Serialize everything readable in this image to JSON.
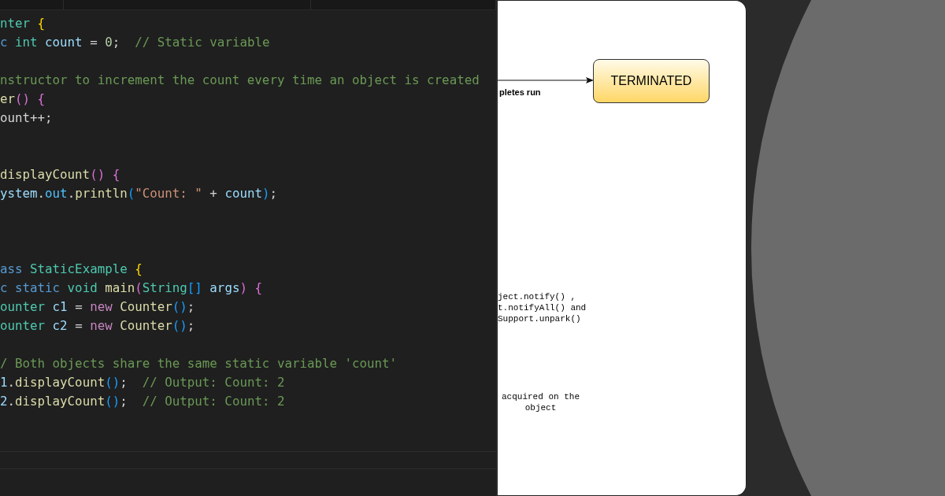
{
  "editor": {
    "lines": [
      {
        "kind": "code",
        "tokens": [
          {
            "text": "nter",
            "kind": "type"
          },
          {
            "text": " {",
            "kind": "brace"
          }
        ]
      },
      {
        "kind": "code",
        "tokens": [
          {
            "text": "c",
            "kind": "keyword"
          },
          {
            "text": " int",
            "kind": "type"
          },
          {
            "text": " count",
            "kind": "variable"
          },
          {
            "text": " = ",
            "kind": "plain"
          },
          {
            "text": "0",
            "kind": "number"
          },
          {
            "text": ";  ",
            "kind": "plain"
          },
          {
            "text": "// Static variable",
            "kind": "comment"
          }
        ]
      },
      {
        "kind": "blank"
      },
      {
        "kind": "code",
        "tokens": [
          {
            "text": "nstructor to increment the count every time an object is created",
            "kind": "comment"
          }
        ]
      },
      {
        "kind": "code",
        "tokens": [
          {
            "text": "er",
            "kind": "function"
          },
          {
            "text": "() {",
            "kind": "paren"
          }
        ]
      },
      {
        "kind": "code",
        "tokens": [
          {
            "text": "ount++;",
            "kind": "plain"
          }
        ]
      },
      {
        "kind": "blank"
      },
      {
        "kind": "blank"
      },
      {
        "kind": "code",
        "tokens": [
          {
            "text": "displayCount",
            "kind": "function"
          },
          {
            "text": "() {",
            "kind": "paren"
          }
        ]
      },
      {
        "kind": "code",
        "tokens": [
          {
            "text": "ystem",
            "kind": "variable"
          },
          {
            "text": ".",
            "kind": "plain"
          },
          {
            "text": "out",
            "kind": "constant"
          },
          {
            "text": ".",
            "kind": "plain"
          },
          {
            "text": "println",
            "kind": "function"
          },
          {
            "text": "(",
            "kind": "bracket"
          },
          {
            "text": "\"Count: \"",
            "kind": "string"
          },
          {
            "text": " + ",
            "kind": "plain"
          },
          {
            "text": "count",
            "kind": "variable"
          },
          {
            "text": ")",
            "kind": "bracket"
          },
          {
            "text": ";",
            "kind": "plain"
          }
        ]
      },
      {
        "kind": "blank"
      },
      {
        "kind": "blank"
      },
      {
        "kind": "blank"
      },
      {
        "kind": "code",
        "tokens": [
          {
            "text": "ass",
            "kind": "keyword"
          },
          {
            "text": " StaticExample",
            "kind": "type"
          },
          {
            "text": " {",
            "kind": "brace"
          }
        ]
      },
      {
        "kind": "code",
        "tokens": [
          {
            "text": "c static",
            "kind": "keyword"
          },
          {
            "text": " void",
            "kind": "type"
          },
          {
            "text": " main",
            "kind": "function"
          },
          {
            "text": "(",
            "kind": "paren"
          },
          {
            "text": "String",
            "kind": "type"
          },
          {
            "text": "[]",
            "kind": "bracket"
          },
          {
            "text": " args",
            "kind": "variable"
          },
          {
            "text": ") {",
            "kind": "paren"
          }
        ]
      },
      {
        "kind": "code",
        "tokens": [
          {
            "text": "ounter",
            "kind": "type"
          },
          {
            "text": " c1",
            "kind": "variable"
          },
          {
            "text": " = ",
            "kind": "plain"
          },
          {
            "text": "new",
            "kind": "control"
          },
          {
            "text": " Counter",
            "kind": "function"
          },
          {
            "text": "()",
            "kind": "bracket"
          },
          {
            "text": ";",
            "kind": "plain"
          }
        ]
      },
      {
        "kind": "code",
        "tokens": [
          {
            "text": "ounter",
            "kind": "type"
          },
          {
            "text": " c2",
            "kind": "variable"
          },
          {
            "text": " = ",
            "kind": "plain"
          },
          {
            "text": "new",
            "kind": "control"
          },
          {
            "text": " Counter",
            "kind": "function"
          },
          {
            "text": "()",
            "kind": "bracket"
          },
          {
            "text": ";",
            "kind": "plain"
          }
        ]
      },
      {
        "kind": "blank"
      },
      {
        "kind": "code",
        "tokens": [
          {
            "text": "/ Both objects share the same static variable 'count'",
            "kind": "comment"
          }
        ]
      },
      {
        "kind": "code",
        "tokens": [
          {
            "text": "1",
            "kind": "variable"
          },
          {
            "text": ".",
            "kind": "plain"
          },
          {
            "text": "displayCount",
            "kind": "function"
          },
          {
            "text": "()",
            "kind": "bracket"
          },
          {
            "text": ";  ",
            "kind": "plain"
          },
          {
            "text": "// Output: Count: 2",
            "kind": "comment"
          }
        ]
      },
      {
        "kind": "code",
        "tokens": [
          {
            "text": "2",
            "kind": "variable"
          },
          {
            "text": ".",
            "kind": "plain"
          },
          {
            "text": "displayCount",
            "kind": "function"
          },
          {
            "text": "()",
            "kind": "bracket"
          },
          {
            "text": ";  ",
            "kind": "plain"
          },
          {
            "text": "// Output: Count: 2",
            "kind": "comment"
          }
        ]
      }
    ]
  },
  "diagram": {
    "state": {
      "label": "TERMINATED"
    },
    "edge_label": "pletes run",
    "notes": [
      {
        "lines": [
          "ject.notify() ,",
          "t.notifyAll() and",
          "Support.unpark()"
        ]
      },
      {
        "lines": [
          "acquired on the",
          "object"
        ]
      }
    ]
  }
}
